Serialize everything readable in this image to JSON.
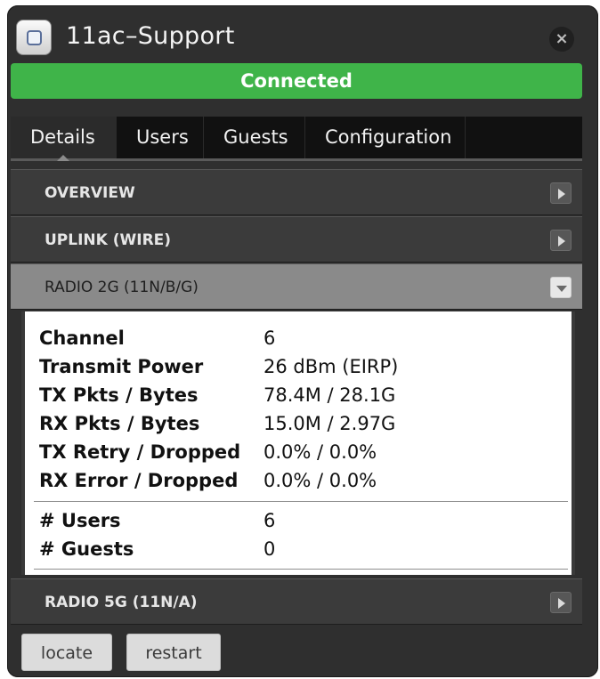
{
  "window": {
    "title": "11ac–Support",
    "close_glyph": "×"
  },
  "status": {
    "label": "Connected",
    "color": "#3fb449"
  },
  "tabs": [
    {
      "label": "Details",
      "active": true
    },
    {
      "label": "Users"
    },
    {
      "label": "Guests"
    },
    {
      "label": "Configuration"
    }
  ],
  "sections": {
    "overview": "OVERVIEW",
    "uplink": "UPLINK (WIRE)",
    "radio2g": "RADIO 2G (11N/B/G)",
    "radio5g": "RADIO 5G (11N/A)"
  },
  "radio2g_details": [
    {
      "key": "Channel",
      "value": "6"
    },
    {
      "key": "Transmit Power",
      "value": "26 dBm (EIRP)"
    },
    {
      "key": "TX Pkts / Bytes",
      "value": "78.4M / 28.1G"
    },
    {
      "key": "RX Pkts / Bytes",
      "value": "15.0M / 2.97G"
    },
    {
      "key": "TX Retry / Dropped",
      "value": "0.0% / 0.0%"
    },
    {
      "key": "RX Error / Dropped",
      "value": "0.0% / 0.0%"
    }
  ],
  "radio2g_counts": [
    {
      "key": "# Users",
      "value": "6"
    },
    {
      "key": "# Guests",
      "value": "0"
    }
  ],
  "actions": {
    "locate": "locate",
    "restart": "restart"
  },
  "icons": {
    "app": "device-square-icon",
    "close": "close-icon",
    "collapsed": "chevron-right-icon",
    "expanded": "chevron-down-icon"
  }
}
